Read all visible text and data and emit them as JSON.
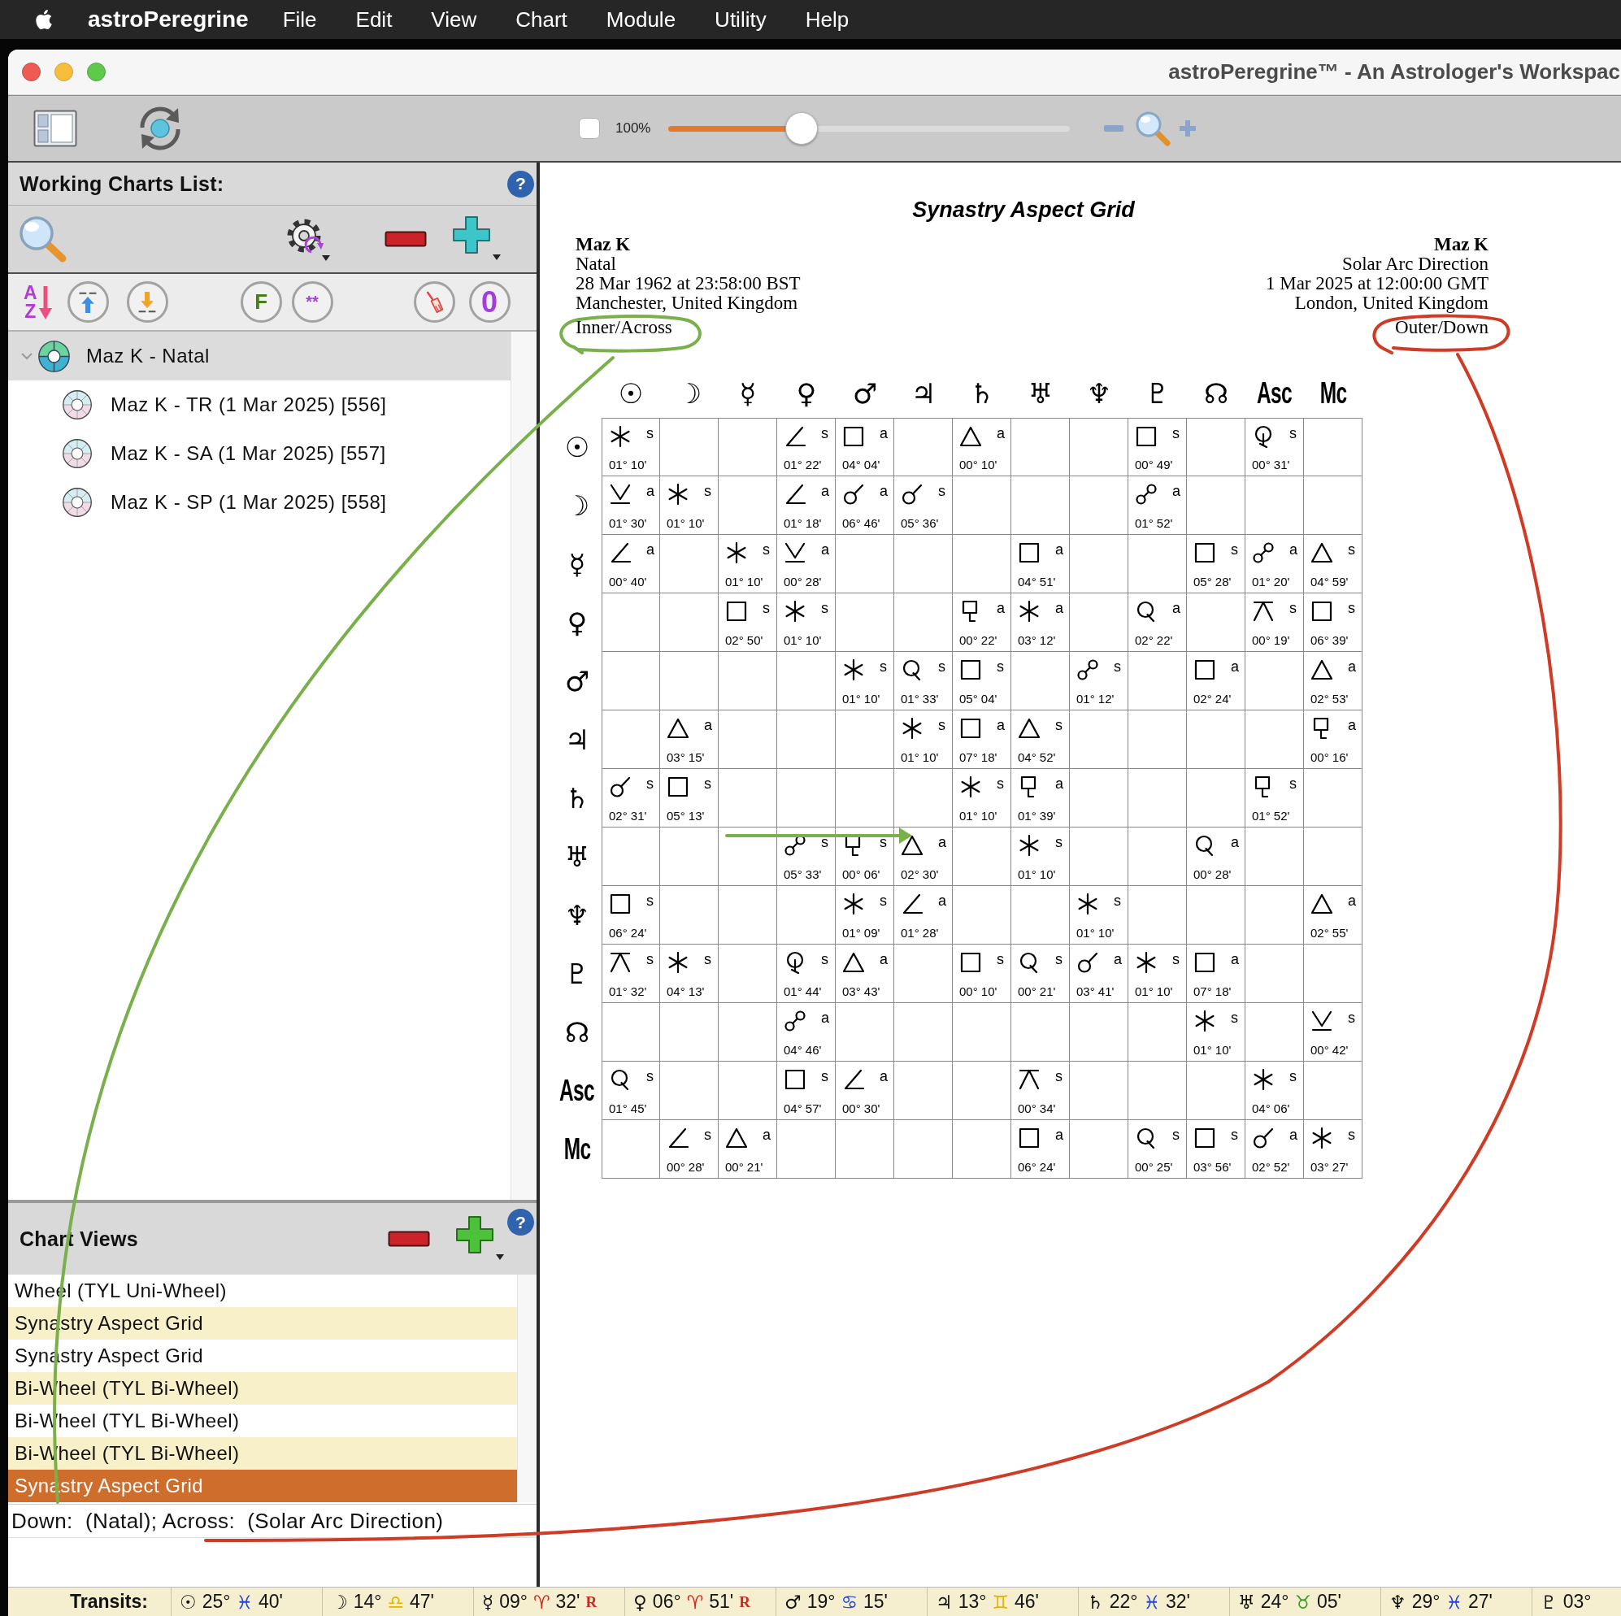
{
  "menu_bar": {
    "app_name": "astroPeregrine",
    "items": [
      "File",
      "Edit",
      "View",
      "Chart",
      "Module",
      "Utility",
      "Help"
    ]
  },
  "window": {
    "title": "astroPeregrine™ - An Astrologer's Workspac"
  },
  "toolbar": {
    "lock": {
      "checked": false
    },
    "zoom_label": "100%",
    "zoom": {
      "level": 0.33
    }
  },
  "working_charts": {
    "title": "Working Charts List:",
    "help": "?",
    "sort_letters": [
      "A",
      "Z"
    ],
    "filter_label": "F",
    "favorites_label": "**",
    "count": "0",
    "tree": [
      {
        "label": "Maz K - Natal",
        "kind": "natal",
        "selected": true,
        "expanded": true,
        "children": [
          {
            "label": "Maz K - TR (1 Mar 2025) [556]",
            "kind": "progressed",
            "selected": false
          },
          {
            "label": "Maz K - SA (1 Mar 2025) [557]",
            "kind": "progressed",
            "selected": false
          },
          {
            "label": "Maz K - SP (1 Mar 2025) [558]",
            "kind": "progressed",
            "selected": false
          }
        ]
      }
    ]
  },
  "chart_views": {
    "title": "Chart Views",
    "help": "?",
    "items": [
      {
        "label": "Wheel (TYL Uni-Wheel)",
        "selected": false
      },
      {
        "label": "Synastry Aspect Grid",
        "selected": false
      },
      {
        "label": "Synastry Aspect Grid",
        "selected": false
      },
      {
        "label": "Bi-Wheel (TYL Bi-Wheel)",
        "selected": false
      },
      {
        "label": "Bi-Wheel (TYL Bi-Wheel)",
        "selected": false
      },
      {
        "label": "Bi-Wheel (TYL Bi-Wheel)",
        "selected": false
      },
      {
        "label": "Synastry Aspect Grid",
        "selected": true
      }
    ],
    "footer": "Down:  (Natal); Across:  (Solar Arc Direction)"
  },
  "aspect_grid": {
    "title": "Synastry Aspect Grid",
    "inner_chart": [
      "Maz K",
      "Natal",
      "28 Mar 1962 at 23:58:00 BST",
      "Manchester, United Kingdom",
      "Inner/Across"
    ],
    "outer_chart": [
      "Maz K",
      "Solar Arc Direction",
      "1 Mar 2025 at 12:00:00 GMT",
      "London, United Kingdom",
      "Outer/Down"
    ],
    "columns": [
      {
        "label": "☉",
        "kind": "planet"
      },
      {
        "label": "☽",
        "kind": "planet"
      },
      {
        "label": "☿",
        "kind": "planet"
      },
      {
        "label": "♀",
        "kind": "planet"
      },
      {
        "label": "♂",
        "kind": "planet"
      },
      {
        "label": "♃",
        "kind": "planet"
      },
      {
        "label": "♄",
        "kind": "planet"
      },
      {
        "label": "♅",
        "kind": "planet"
      },
      {
        "label": "♆",
        "kind": "planet"
      },
      {
        "label": "♇",
        "kind": "planet"
      },
      {
        "label": "☊",
        "kind": "planet"
      },
      {
        "label": "Asc",
        "kind": "angle"
      },
      {
        "label": "Mc",
        "kind": "angle"
      }
    ],
    "rows": [
      {
        "label": "☉",
        "kind": "planet",
        "cells": [
          {
            "kind": "sextile",
            "phase": "s",
            "orb": "01° 10'"
          },
          {
            "kind": "empty"
          },
          {
            "kind": "empty"
          },
          {
            "kind": "semisquare",
            "phase": "s",
            "orb": "01° 22'"
          },
          {
            "kind": "square",
            "phase": "a",
            "orb": "04° 04'"
          },
          {
            "kind": "empty"
          },
          {
            "kind": "trine",
            "phase": "a",
            "orb": "00° 10'"
          },
          {
            "kind": "empty"
          },
          {
            "kind": "empty"
          },
          {
            "kind": "square",
            "phase": "s",
            "orb": "00° 49'"
          },
          {
            "kind": "empty"
          },
          {
            "kind": "biquintile",
            "phase": "s",
            "orb": "00° 31'"
          },
          {
            "kind": "empty"
          }
        ]
      },
      {
        "label": "☽",
        "kind": "planet",
        "cells": [
          {
            "kind": "semisextile",
            "phase": "a",
            "orb": "01° 30'"
          },
          {
            "kind": "sextile",
            "phase": "s",
            "orb": "01° 10'"
          },
          {
            "kind": "empty"
          },
          {
            "kind": "semisquare",
            "phase": "a",
            "orb": "01° 18'"
          },
          {
            "kind": "conjunction",
            "phase": "a",
            "orb": "06° 46'"
          },
          {
            "kind": "conjunction",
            "phase": "s",
            "orb": "05° 36'"
          },
          {
            "kind": "empty"
          },
          {
            "kind": "empty"
          },
          {
            "kind": "empty"
          },
          {
            "kind": "opposition",
            "phase": "a",
            "orb": "01° 52'"
          },
          {
            "kind": "empty"
          },
          {
            "kind": "empty"
          },
          {
            "kind": "empty"
          }
        ]
      },
      {
        "label": "☿",
        "kind": "planet",
        "cells": [
          {
            "kind": "semisquare",
            "phase": "a",
            "orb": "00° 40'"
          },
          {
            "kind": "empty"
          },
          {
            "kind": "sextile",
            "phase": "s",
            "orb": "01° 10'"
          },
          {
            "kind": "semisextile",
            "phase": "a",
            "orb": "00° 28'"
          },
          {
            "kind": "empty"
          },
          {
            "kind": "empty"
          },
          {
            "kind": "empty"
          },
          {
            "kind": "square",
            "phase": "a",
            "orb": "04° 51'"
          },
          {
            "kind": "empty"
          },
          {
            "kind": "empty"
          },
          {
            "kind": "square",
            "phase": "s",
            "orb": "05° 28'"
          },
          {
            "kind": "opposition",
            "phase": "a",
            "orb": "01° 20'"
          },
          {
            "kind": "trine",
            "phase": "s",
            "orb": "04° 59'"
          }
        ]
      },
      {
        "label": "♀",
        "kind": "planet",
        "cells": [
          {
            "kind": "empty"
          },
          {
            "kind": "empty"
          },
          {
            "kind": "square",
            "phase": "s",
            "orb": "02° 50'"
          },
          {
            "kind": "sextile",
            "phase": "s",
            "orb": "01° 10'"
          },
          {
            "kind": "empty"
          },
          {
            "kind": "empty"
          },
          {
            "kind": "sesquiquadrate",
            "phase": "a",
            "orb": "00° 22'"
          },
          {
            "kind": "sextile",
            "phase": "a",
            "orb": "03° 12'"
          },
          {
            "kind": "empty"
          },
          {
            "kind": "quintile",
            "phase": "a",
            "orb": "02° 22'"
          },
          {
            "kind": "empty"
          },
          {
            "kind": "quincunx",
            "phase": "s",
            "orb": "00° 19'"
          },
          {
            "kind": "square",
            "phase": "s",
            "orb": "06° 39'"
          }
        ]
      },
      {
        "label": "♂",
        "kind": "planet",
        "cells": [
          {
            "kind": "empty"
          },
          {
            "kind": "empty"
          },
          {
            "kind": "empty"
          },
          {
            "kind": "empty"
          },
          {
            "kind": "sextile",
            "phase": "s",
            "orb": "01° 10'"
          },
          {
            "kind": "quintile",
            "phase": "s",
            "orb": "01° 33'"
          },
          {
            "kind": "square",
            "phase": "s",
            "orb": "05° 04'"
          },
          {
            "kind": "empty"
          },
          {
            "kind": "opposition",
            "phase": "s",
            "orb": "01° 12'"
          },
          {
            "kind": "empty"
          },
          {
            "kind": "square",
            "phase": "a",
            "orb": "02° 24'"
          },
          {
            "kind": "empty"
          },
          {
            "kind": "trine",
            "phase": "a",
            "orb": "02° 53'"
          }
        ]
      },
      {
        "label": "♃",
        "kind": "planet",
        "cells": [
          {
            "kind": "empty"
          },
          {
            "kind": "trine",
            "phase": "a",
            "orb": "03° 15'"
          },
          {
            "kind": "empty"
          },
          {
            "kind": "empty"
          },
          {
            "kind": "empty"
          },
          {
            "kind": "sextile",
            "phase": "s",
            "orb": "01° 10'"
          },
          {
            "kind": "square",
            "phase": "a",
            "orb": "07° 18'"
          },
          {
            "kind": "trine",
            "phase": "s",
            "orb": "04° 52'"
          },
          {
            "kind": "empty"
          },
          {
            "kind": "empty"
          },
          {
            "kind": "empty"
          },
          {
            "kind": "empty"
          },
          {
            "kind": "sesquiquadrate",
            "phase": "a",
            "orb": "00° 16'"
          }
        ]
      },
      {
        "label": "♄",
        "kind": "planet",
        "cells": [
          {
            "kind": "conjunction",
            "phase": "s",
            "orb": "02° 31'"
          },
          {
            "kind": "square",
            "phase": "s",
            "orb": "05° 13'"
          },
          {
            "kind": "empty"
          },
          {
            "kind": "empty"
          },
          {
            "kind": "empty"
          },
          {
            "kind": "empty"
          },
          {
            "kind": "sextile",
            "phase": "s",
            "orb": "01° 10'"
          },
          {
            "kind": "sesquiquadrate",
            "phase": "a",
            "orb": "01° 39'"
          },
          {
            "kind": "empty"
          },
          {
            "kind": "empty"
          },
          {
            "kind": "empty"
          },
          {
            "kind": "sesquiquadrate",
            "phase": "s",
            "orb": "01° 52'"
          },
          {
            "kind": "empty"
          }
        ]
      },
      {
        "label": "♅",
        "kind": "planet",
        "cells": [
          {
            "kind": "empty"
          },
          {
            "kind": "empty"
          },
          {
            "kind": "empty"
          },
          {
            "kind": "opposition",
            "phase": "s",
            "orb": "05° 33'"
          },
          {
            "kind": "sesquiquadrate",
            "phase": "s",
            "orb": "00° 06'"
          },
          {
            "kind": "trine",
            "phase": "a",
            "orb": "02° 30'"
          },
          {
            "kind": "empty"
          },
          {
            "kind": "sextile",
            "phase": "s",
            "orb": "01° 10'"
          },
          {
            "kind": "empty"
          },
          {
            "kind": "empty"
          },
          {
            "kind": "quintile",
            "phase": "a",
            "orb": "00° 28'"
          },
          {
            "kind": "empty"
          },
          {
            "kind": "empty"
          }
        ]
      },
      {
        "label": "♆",
        "kind": "planet",
        "cells": [
          {
            "kind": "square",
            "phase": "s",
            "orb": "06° 24'"
          },
          {
            "kind": "empty"
          },
          {
            "kind": "empty"
          },
          {
            "kind": "empty"
          },
          {
            "kind": "sextile",
            "phase": "s",
            "orb": "01° 09'"
          },
          {
            "kind": "semisquare",
            "phase": "a",
            "orb": "01° 28'"
          },
          {
            "kind": "empty"
          },
          {
            "kind": "empty"
          },
          {
            "kind": "sextile",
            "phase": "s",
            "orb": "01° 10'"
          },
          {
            "kind": "empty"
          },
          {
            "kind": "empty"
          },
          {
            "kind": "empty"
          },
          {
            "kind": "trine",
            "phase": "a",
            "orb": "02° 55'"
          }
        ]
      },
      {
        "label": "♇",
        "kind": "planet",
        "cells": [
          {
            "kind": "quincunx",
            "phase": "s",
            "orb": "01° 32'"
          },
          {
            "kind": "sextile",
            "phase": "s",
            "orb": "04° 13'"
          },
          {
            "kind": "empty"
          },
          {
            "kind": "biquintile",
            "phase": "s",
            "orb": "01° 44'"
          },
          {
            "kind": "trine",
            "phase": "a",
            "orb": "03° 43'"
          },
          {
            "kind": "empty"
          },
          {
            "kind": "square",
            "phase": "s",
            "orb": "00° 10'"
          },
          {
            "kind": "quintile",
            "phase": "s",
            "orb": "00° 21'"
          },
          {
            "kind": "conjunction",
            "phase": "a",
            "orb": "03° 41'"
          },
          {
            "kind": "sextile",
            "phase": "s",
            "orb": "01° 10'"
          },
          {
            "kind": "square",
            "phase": "a",
            "orb": "07° 18'"
          },
          {
            "kind": "empty"
          },
          {
            "kind": "empty"
          }
        ]
      },
      {
        "label": "☊",
        "kind": "planet",
        "cells": [
          {
            "kind": "empty"
          },
          {
            "kind": "empty"
          },
          {
            "kind": "empty"
          },
          {
            "kind": "opposition",
            "phase": "a",
            "orb": "04° 46'"
          },
          {
            "kind": "empty"
          },
          {
            "kind": "empty"
          },
          {
            "kind": "empty"
          },
          {
            "kind": "empty"
          },
          {
            "kind": "empty"
          },
          {
            "kind": "empty"
          },
          {
            "kind": "sextile",
            "phase": "s",
            "orb": "01° 10'"
          },
          {
            "kind": "empty"
          },
          {
            "kind": "semisextile",
            "phase": "s",
            "orb": "00° 42'"
          }
        ]
      },
      {
        "label": "Asc",
        "kind": "angle",
        "cells": [
          {
            "kind": "quintile",
            "phase": "s",
            "orb": "01° 45'"
          },
          {
            "kind": "empty"
          },
          {
            "kind": "empty"
          },
          {
            "kind": "square",
            "phase": "s",
            "orb": "04° 57'"
          },
          {
            "kind": "semisquare",
            "phase": "a",
            "orb": "00° 30'"
          },
          {
            "kind": "empty"
          },
          {
            "kind": "empty"
          },
          {
            "kind": "quincunx",
            "phase": "s",
            "orb": "00° 34'"
          },
          {
            "kind": "empty"
          },
          {
            "kind": "empty"
          },
          {
            "kind": "empty"
          },
          {
            "kind": "sextile",
            "phase": "s",
            "orb": "04° 06'"
          },
          {
            "kind": "empty"
          }
        ]
      },
      {
        "label": "Mc",
        "kind": "angle",
        "cells": [
          {
            "kind": "empty"
          },
          {
            "kind": "semisquare",
            "phase": "s",
            "orb": "00° 28'"
          },
          {
            "kind": "trine",
            "phase": "a",
            "orb": "00° 21'"
          },
          {
            "kind": "empty"
          },
          {
            "kind": "empty"
          },
          {
            "kind": "empty"
          },
          {
            "kind": "empty"
          },
          {
            "kind": "square",
            "phase": "a",
            "orb": "06° 24'"
          },
          {
            "kind": "empty"
          },
          {
            "kind": "quintile",
            "phase": "s",
            "orb": "00° 25'"
          },
          {
            "kind": "square",
            "phase": "s",
            "orb": "03° 56'"
          },
          {
            "kind": "conjunction",
            "phase": "a",
            "orb": "02° 52'"
          },
          {
            "kind": "sextile",
            "phase": "s",
            "orb": "03° 27'"
          }
        ]
      }
    ]
  },
  "status_bar": {
    "label": "Transits:",
    "items": [
      {
        "planet": "☉",
        "degrees": "25°",
        "sign": "♓",
        "color": "#2244dd",
        "minutes": "40'"
      },
      {
        "planet": "☽",
        "degrees": "14°",
        "sign": "♎",
        "color": "#e2b400",
        "minutes": "47'"
      },
      {
        "planet": "☿",
        "degrees": "09°",
        "sign": "♈",
        "color": "#d9261c",
        "minutes": "32'",
        "retrograde": "R"
      },
      {
        "planet": "♀",
        "degrees": "06°",
        "sign": "♈",
        "color": "#d9261c",
        "minutes": "51'",
        "retrograde": "R"
      },
      {
        "planet": "♂",
        "degrees": "19°",
        "sign": "♋",
        "color": "#2244dd",
        "minutes": "15'"
      },
      {
        "planet": "♃",
        "degrees": "13°",
        "sign": "♊",
        "color": "#e2b400",
        "minutes": "46'"
      },
      {
        "planet": "♄",
        "degrees": "22°",
        "sign": "♓",
        "color": "#2244dd",
        "minutes": "32'"
      },
      {
        "planet": "♅",
        "degrees": "24°",
        "sign": "♉",
        "color": "#3c9a2c",
        "minutes": "05'"
      },
      {
        "planet": "♆",
        "degrees": "29°",
        "sign": "♓",
        "color": "#2244dd",
        "minutes": "27'"
      },
      {
        "planet": "♇",
        "degrees": "03°"
      }
    ]
  }
}
